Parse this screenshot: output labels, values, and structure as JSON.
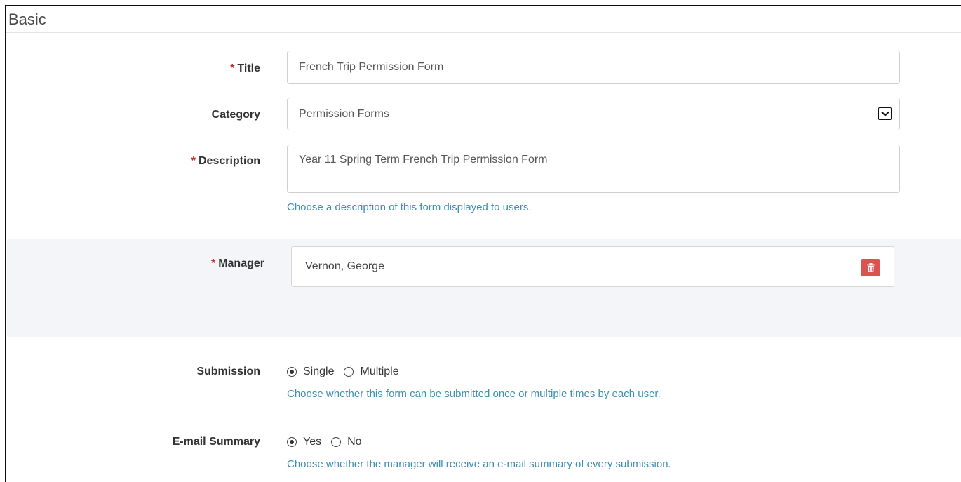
{
  "section": {
    "title": "Basic"
  },
  "fields": {
    "title": {
      "label": "Title",
      "required_mark": "*",
      "value": "French Trip Permission Form"
    },
    "category": {
      "label": "Category",
      "value": "Permission Forms"
    },
    "description": {
      "label": "Description",
      "required_mark": "*",
      "value": "Year 11 Spring Term French Trip Permission Form",
      "help": "Choose a description of this form displayed to users."
    },
    "manager": {
      "label": "Manager",
      "required_mark": "*",
      "value": "Vernon, George"
    },
    "submission": {
      "label": "Submission",
      "options": [
        {
          "label": "Single",
          "selected": true
        },
        {
          "label": "Multiple",
          "selected": false
        }
      ],
      "help": "Choose whether this form can be submitted once or multiple times by each user."
    },
    "email_summary": {
      "label": "E-mail Summary",
      "options": [
        {
          "label": "Yes",
          "selected": true
        },
        {
          "label": "No",
          "selected": false
        }
      ],
      "help": "Choose whether the manager will receive an e-mail summary of every submission."
    }
  },
  "icons": {
    "select_arrow": "chevron-down-icon",
    "delete": "trash-icon"
  },
  "colors": {
    "required": "#c9302c",
    "help_text": "#3d8fb3",
    "delete_button": "#d9534f",
    "manager_panel": "#f3f5f8"
  }
}
